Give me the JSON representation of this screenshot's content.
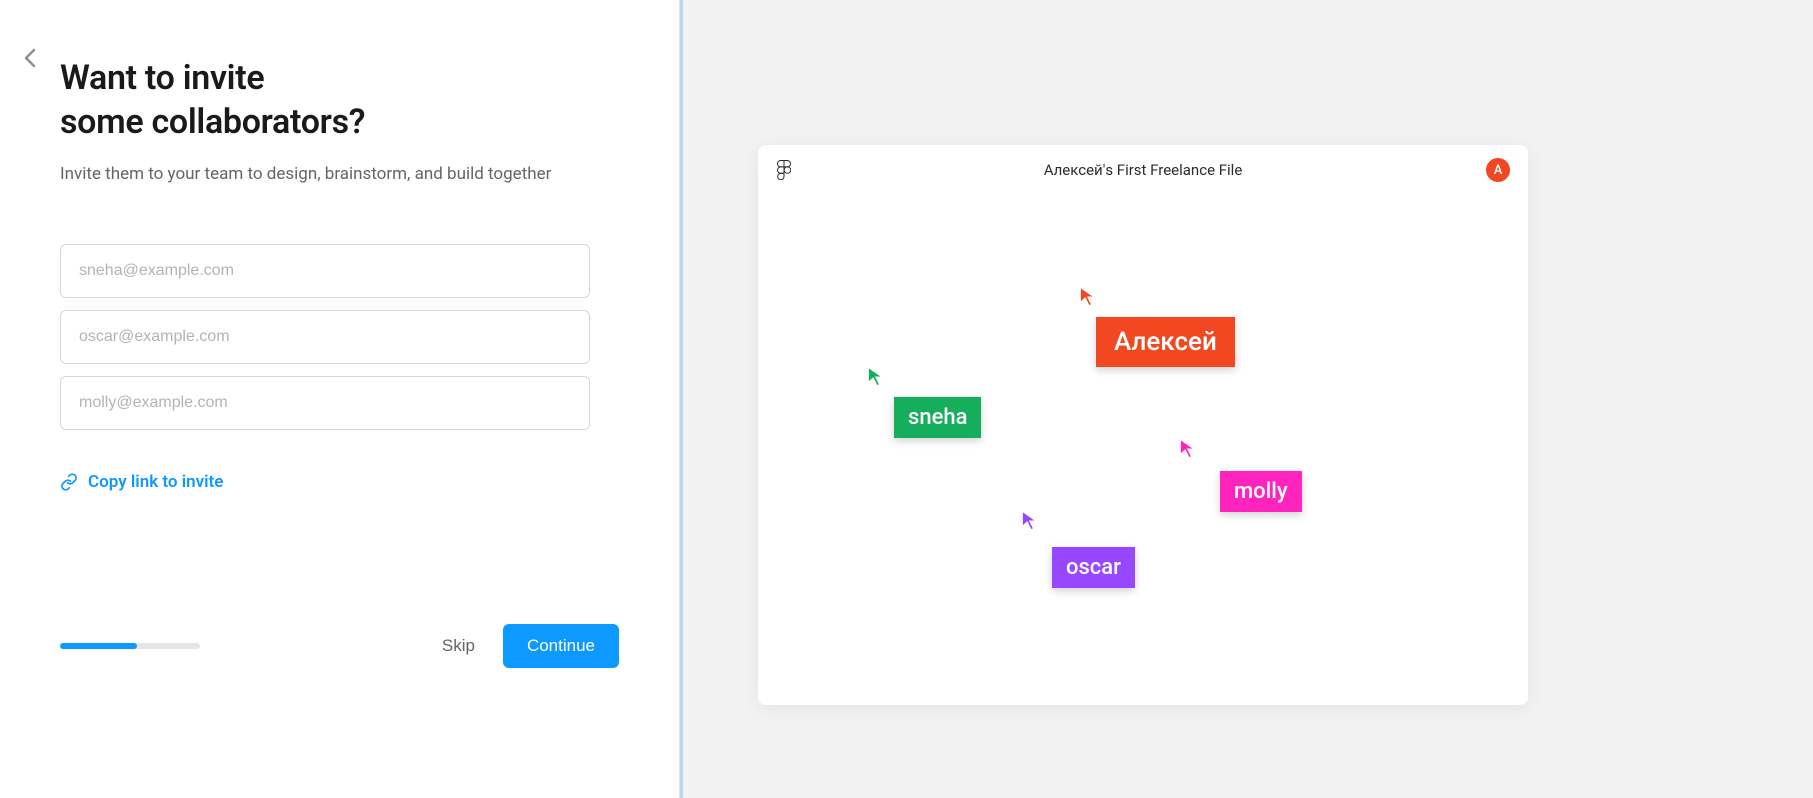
{
  "heading_line1": "Want to invite",
  "heading_line2": "some collaborators?",
  "subheading": "Invite them to your team to design, brainstorm, and build together",
  "inputs": {
    "email1_placeholder": "sneha@example.com",
    "email2_placeholder": "oscar@example.com",
    "email3_placeholder": "molly@example.com"
  },
  "copy_link_label": "Copy link to invite",
  "footer": {
    "skip_label": "Skip",
    "continue_label": "Continue",
    "progress_percent": 55
  },
  "preview": {
    "file_title": "Алексей's First Freelance File",
    "avatar_initial": "A",
    "cursors": {
      "owner": {
        "label": "Алексей",
        "color": "#f24822"
      },
      "sneha": {
        "label": "sneha",
        "color": "#14ae5c"
      },
      "molly": {
        "label": "molly",
        "color": "#ff24bd"
      },
      "oscar": {
        "label": "oscar",
        "color": "#9747ff"
      }
    }
  },
  "colors": {
    "accent": "#0d99ff"
  }
}
